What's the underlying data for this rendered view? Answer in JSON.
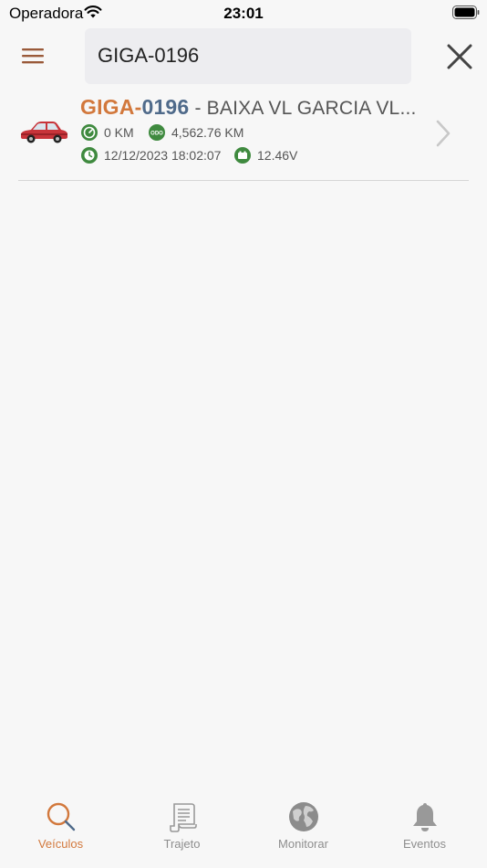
{
  "status_bar": {
    "carrier": "Operadora",
    "time": "23:01"
  },
  "search": {
    "value": "GIGA-0196"
  },
  "vehicle": {
    "plate_part1": "GIGA-",
    "plate_part2": "0196",
    "description": " - BAIXA VL GARCIA VL...",
    "speed": "0 KM",
    "odometer": "4,562.76 KM",
    "datetime": "12/12/2023 18:02:07",
    "voltage": "12.46V",
    "odo_badge": "ODO"
  },
  "tabs": [
    {
      "label": "Veículos",
      "icon": "search-icon",
      "active": true
    },
    {
      "label": "Trajeto",
      "icon": "route-icon",
      "active": false
    },
    {
      "label": "Monitorar",
      "icon": "globe-icon",
      "active": false
    },
    {
      "label": "Eventos",
      "icon": "bell-icon",
      "active": false
    }
  ],
  "colors": {
    "accent": "#d2783c",
    "plate_blue": "#4f6a8a",
    "status_green": "#3f8a3f"
  }
}
